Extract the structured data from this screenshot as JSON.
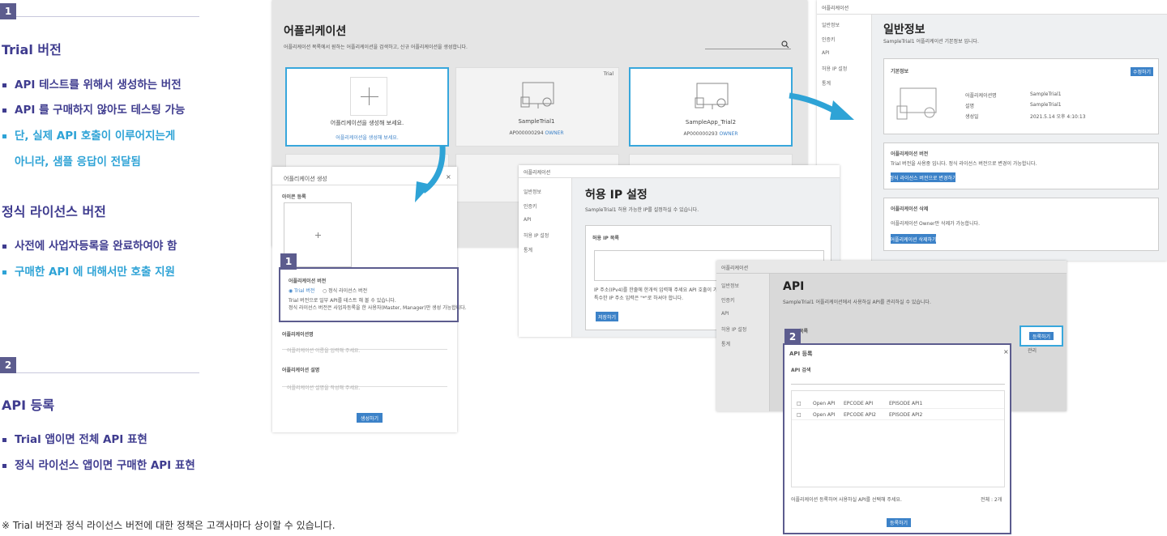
{
  "left": {
    "badge1": "1",
    "trial_title": "Trial 버전",
    "trial_bullets": [
      "API 테스트를 위해서 생성하는 버전",
      "API 를 구매하지 않아도 테스팅 가능",
      "단, 실제 API 호출이 이루어지는게",
      "아니라, 샘플 응답이 전달됨"
    ],
    "license_title": "정식 라이선스 버전",
    "license_bullets": [
      "사전에 사업자등록을 완료하여야 함",
      "구매한 API 에 대해서만 호출 지원"
    ],
    "badge2": "2",
    "api_title": "API 등록",
    "api_bullets": [
      "Trial 앱이면 전체 API 표현",
      "정식 라이선스 앱이면 구매한 API 표현"
    ],
    "footnote": "※ Trial 버전과 정식 라이선스 버전에 대한 정책은 고객사마다 상이할 수 있습니다."
  },
  "apps": {
    "title": "어플리케이션",
    "desc": "어플리케이션 목록에서 원하는 어플리케이션을 검색하고, 신규 어플리케이션을 생성합니다.",
    "create_text": "어플리케이션을 생성해 보세요.",
    "create_link": "어플리케이션을 생성해 보세요.",
    "cards": [
      {
        "name": "SampleTrial1",
        "id": "AP000000294",
        "role": "OWNER",
        "tag": "Trial"
      },
      {
        "name": "SampleApp_Trial2",
        "id": "AP000000293",
        "role": "OWNER",
        "tag": ""
      }
    ]
  },
  "modal_create": {
    "title": "어플리케이션 생성",
    "icon_label": "아이콘 등록",
    "version_label": "어플리케이션 버전",
    "opt_trial": "Trial 버전",
    "opt_license": "정식 라이선스 버전",
    "info1": "Trial 버전으로 일부 API를 테스트 해 볼 수 있습니다.",
    "info2": "정식 라이선스 버전은 사업자등록을 한 사용자(Master, Manager)만 생성 가능합니다.",
    "name_label": "어플리케이션명",
    "name_placeholder": "어플리케이션 이름을 입력해 주세요.",
    "desc_label": "어플리케이션 설명",
    "desc_placeholder": "어플리케이션 설명을 작성해 주세요.",
    "submit": "생성하기",
    "badge": "1"
  },
  "info": {
    "breadcrumb": "어플리케이션",
    "nav": [
      "일반정보",
      "인증키",
      "API",
      "허용 IP 설정",
      "통계"
    ],
    "title": "일반정보",
    "desc": "SampleTrial1 어플리케이션 기본정보 입니다.",
    "basic_label": "기본정보",
    "edit_btn": "수정하기",
    "rows": [
      {
        "k": "어플리케이션명",
        "v": "SampleTrial1"
      },
      {
        "k": "설명",
        "v": "SampleTrial1"
      },
      {
        "k": "생성일",
        "v": "2021.5.14 오후 4:10:13"
      }
    ],
    "version_label": "어플리케이션 버전",
    "version_text": "Trial 버전을 사용중 입니다. 정식 라이선스 버전으로 변경이 가능합니다.",
    "version_btn": "정식 라이선스 버전으로 변경하기",
    "delete_label": "어플리케이션 삭제",
    "delete_text": "어플리케이션 Owner만 삭제가 가능합니다.",
    "delete_btn": "어플리케이션 삭제하기"
  },
  "ip": {
    "breadcrumb": "어플리케이션",
    "nav": [
      "일반정보",
      "인증키",
      "API",
      "허용 IP 설정",
      "통계"
    ],
    "title": "허용 IP 설정",
    "desc": "SampleTrial1 허용 가능한 IP를 설정하실 수 있습니다.",
    "box_label": "허용 IP 목록",
    "help1": "IP 주소(IPv4)를 한줄에 한개씩 입력해 주세요 API 호출이 가능합니다.",
    "help2": "특수한 IP 주소 입력은 \"*\"로 하셔야 합니다.",
    "btn": "저장하기"
  },
  "api": {
    "breadcrumb": "어플리케이션",
    "nav": [
      "일반정보",
      "인증키",
      "API",
      "허용 IP 설정",
      "통계"
    ],
    "title": "API",
    "desc": "SampleTrial1 어플리케이션에서 사용하실 API를 관리하실 수 있습니다.",
    "list_label": "목록",
    "reg_btn": "등록하기",
    "col_right": "관리",
    "badge": "2"
  },
  "modal_api": {
    "title": "API 등록",
    "search_label": "API 검색",
    "rows": [
      {
        "a": "Open API",
        "b": "EPCODE API",
        "c": "EPISODE API1"
      },
      {
        "a": "Open API",
        "b": "EPCODE API2",
        "c": "EPISODE API2"
      }
    ],
    "footer_note": "어플리케이션 등록하여 사용하실 API를 선택해 주세요.",
    "count": "전체 : 2개",
    "submit": "등록하기"
  }
}
